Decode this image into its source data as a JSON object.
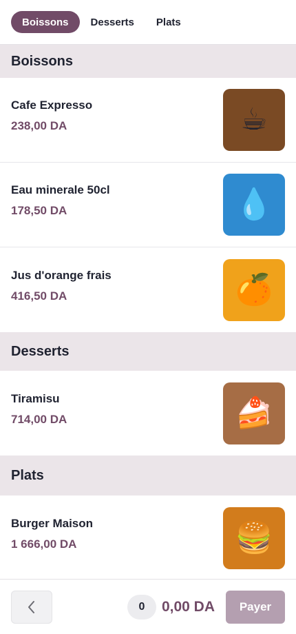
{
  "tabs": [
    {
      "label": "Boissons",
      "active": true
    },
    {
      "label": "Desserts",
      "active": false
    },
    {
      "label": "Plats",
      "active": false
    }
  ],
  "sections": [
    {
      "title": "Boissons",
      "items": [
        {
          "name": "Cafe Expresso",
          "price": "238,00 DA",
          "icon": "coffee-cup-icon",
          "glyph": "☕",
          "bg": "#7a4a24"
        },
        {
          "name": "Eau minerale 50cl",
          "price": "178,50 DA",
          "icon": "water-drop-icon",
          "glyph": "💧",
          "bg": "#2f8bd0"
        },
        {
          "name": "Jus d'orange frais",
          "price": "416,50 DA",
          "icon": "orange-icon",
          "glyph": "🍊",
          "bg": "#f0a21b"
        }
      ]
    },
    {
      "title": "Desserts",
      "items": [
        {
          "name": "Tiramisu",
          "price": "714,00 DA",
          "icon": "cake-slice-icon",
          "glyph": "🍰",
          "bg": "#a66d45"
        }
      ]
    },
    {
      "title": "Plats",
      "items": [
        {
          "name": "Burger Maison",
          "price": "1 666,00 DA",
          "icon": "burger-icon",
          "glyph": "🍔",
          "bg": "#d27c1c"
        }
      ]
    }
  ],
  "footer": {
    "count": "0",
    "total": "0,00 DA",
    "pay_label": "Payer",
    "back_icon": "chevron-left-icon"
  },
  "colors": {
    "accent": "#714b67",
    "pay_disabled": "#b49fb0",
    "section_bg": "#ebe5e9"
  }
}
